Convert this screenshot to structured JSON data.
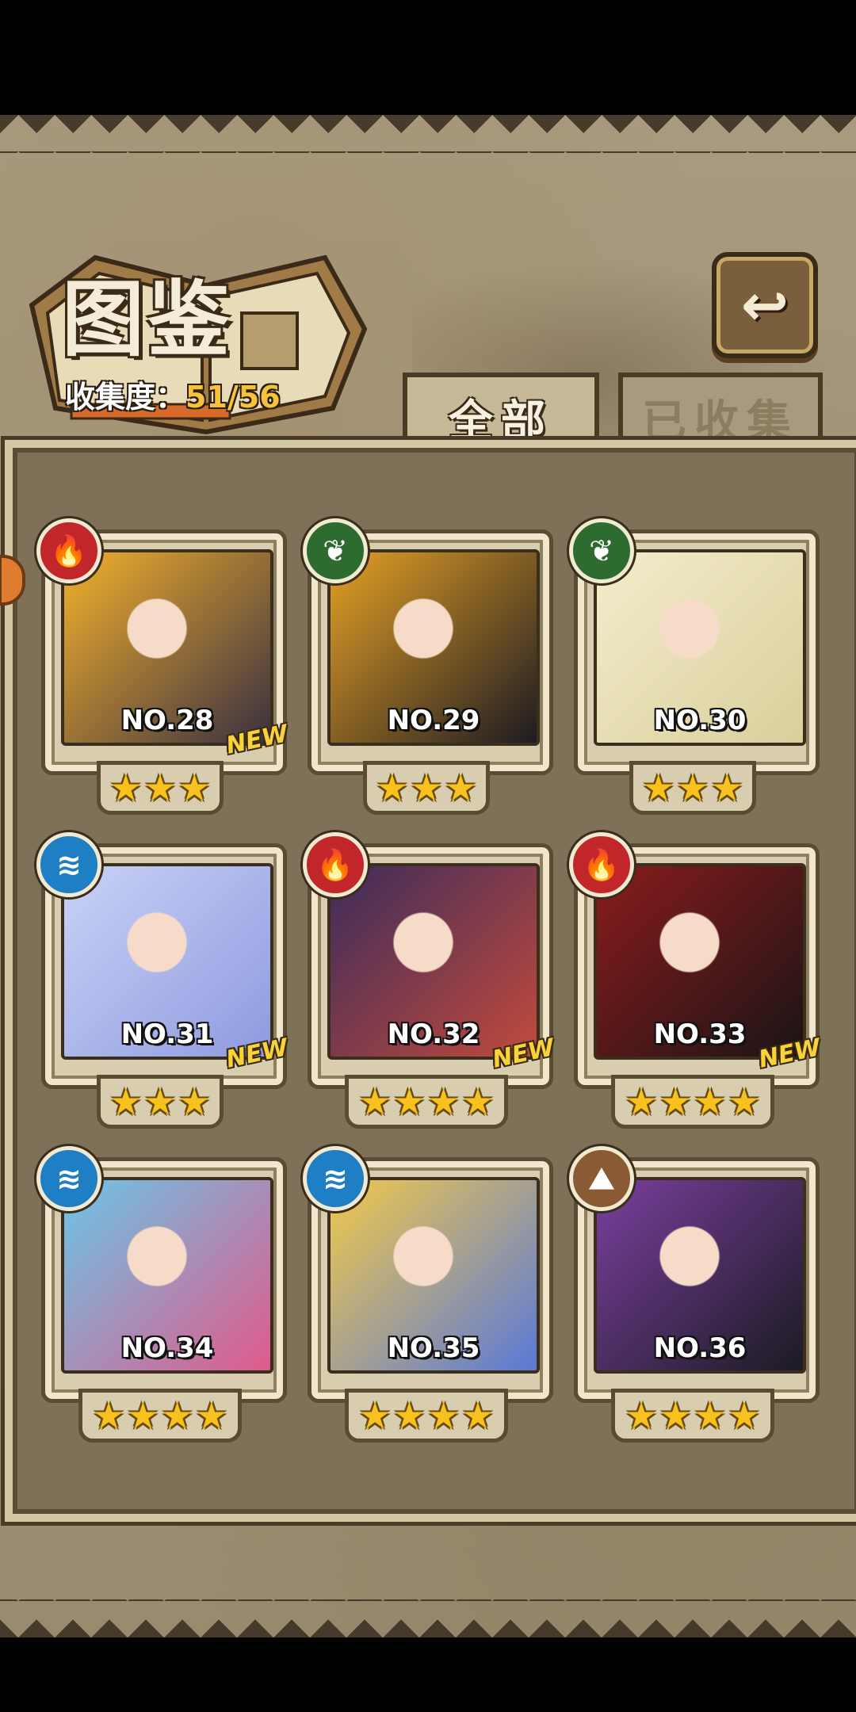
{
  "header": {
    "title": "图鉴",
    "collect_label": "收集度：",
    "collect_value": "51/56",
    "back_icon": "↩"
  },
  "tabs": [
    {
      "label": "全部",
      "active": true
    },
    {
      "label": "已收集",
      "active": false
    }
  ],
  "cards": [
    {
      "no": "NO.28",
      "element": "fire",
      "icon": "🔥",
      "stars": 3,
      "new": true,
      "colors": [
        "#f3b12c",
        "#3a3040"
      ]
    },
    {
      "no": "NO.29",
      "element": "leaf",
      "icon": "❦",
      "stars": 3,
      "new": false,
      "colors": [
        "#e5a125",
        "#1d1b22"
      ]
    },
    {
      "no": "NO.30",
      "element": "leaf",
      "icon": "❦",
      "stars": 3,
      "new": false,
      "colors": [
        "#f4eccc",
        "#d9cf9b"
      ]
    },
    {
      "no": "NO.31",
      "element": "water",
      "icon": "≋",
      "stars": 3,
      "new": true,
      "colors": [
        "#c9d2f5",
        "#8f9ae0"
      ]
    },
    {
      "no": "NO.32",
      "element": "fire",
      "icon": "🔥",
      "stars": 4,
      "new": true,
      "colors": [
        "#3c2c5a",
        "#c24a3c"
      ]
    },
    {
      "no": "NO.33",
      "element": "fire",
      "icon": "🔥",
      "stars": 4,
      "new": true,
      "colors": [
        "#8a1c1c",
        "#1b1416"
      ]
    },
    {
      "no": "NO.34",
      "element": "water",
      "icon": "≋",
      "stars": 4,
      "new": false,
      "colors": [
        "#6bc6e8",
        "#e05a8a"
      ]
    },
    {
      "no": "NO.35",
      "element": "water",
      "icon": "≋",
      "stars": 4,
      "new": false,
      "colors": [
        "#f2c94a",
        "#5a79d8"
      ]
    },
    {
      "no": "NO.36",
      "element": "earth",
      "icon": "⛰",
      "stars": 4,
      "new": false,
      "colors": [
        "#7a3f9e",
        "#1b1b22"
      ]
    }
  ],
  "new_label": "NEW"
}
